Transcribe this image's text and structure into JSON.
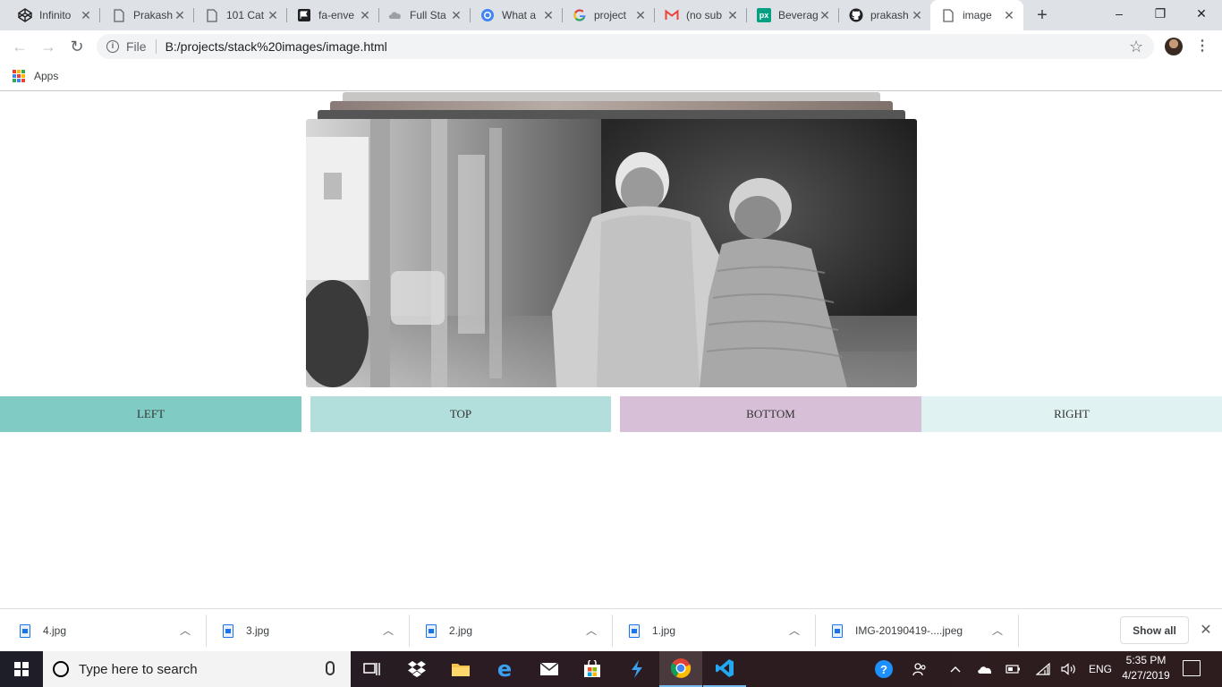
{
  "browser": {
    "tabs": [
      {
        "title": "Infinito",
        "favicon": "codepen-icon",
        "left": 0
      },
      {
        "title": "Prakash",
        "favicon": "doc-icon"
      },
      {
        "title": "101 Cat",
        "favicon": "doc-icon"
      },
      {
        "title": "fa-enve",
        "favicon": "fontawesome-flag-icon"
      },
      {
        "title": "Full Sta",
        "favicon": "cloud-icon"
      },
      {
        "title": "What a",
        "favicon": "chrome-circle-icon"
      },
      {
        "title": "project",
        "favicon": "google-icon"
      },
      {
        "title": "(no sub",
        "favicon": "gmail-icon"
      },
      {
        "title": "Beverag",
        "favicon": "pexels-icon"
      },
      {
        "title": "prakash",
        "favicon": "github-icon"
      },
      {
        "title": "image",
        "favicon": "doc-icon",
        "active": true
      }
    ],
    "window_controls": {
      "minimize": "–",
      "restore": "❐",
      "close": "✕"
    },
    "omnibox": {
      "scheme_label": "File",
      "url": "B:/projects/stack%20images/image.html"
    },
    "bookmarks": {
      "apps_label": "Apps"
    }
  },
  "page": {
    "buttons": [
      {
        "label": "LEFT",
        "color": "#80cbc4"
      },
      {
        "label": "TOP",
        "color": "#b2dfdb"
      },
      {
        "label": "BOTTOM",
        "color": "#d8bfd8"
      },
      {
        "label": "RIGHT",
        "color": "#e0f2f1"
      }
    ]
  },
  "downloads": {
    "items": [
      {
        "name": "4.jpg"
      },
      {
        "name": "3.jpg"
      },
      {
        "name": "2.jpg"
      },
      {
        "name": "1.jpg"
      },
      {
        "name": "IMG-20190419-....jpeg"
      }
    ],
    "show_all_label": "Show all"
  },
  "taskbar": {
    "search_placeholder": "Type here to search",
    "language": "ENG",
    "time": "5:35 PM",
    "date": "4/27/2019"
  }
}
